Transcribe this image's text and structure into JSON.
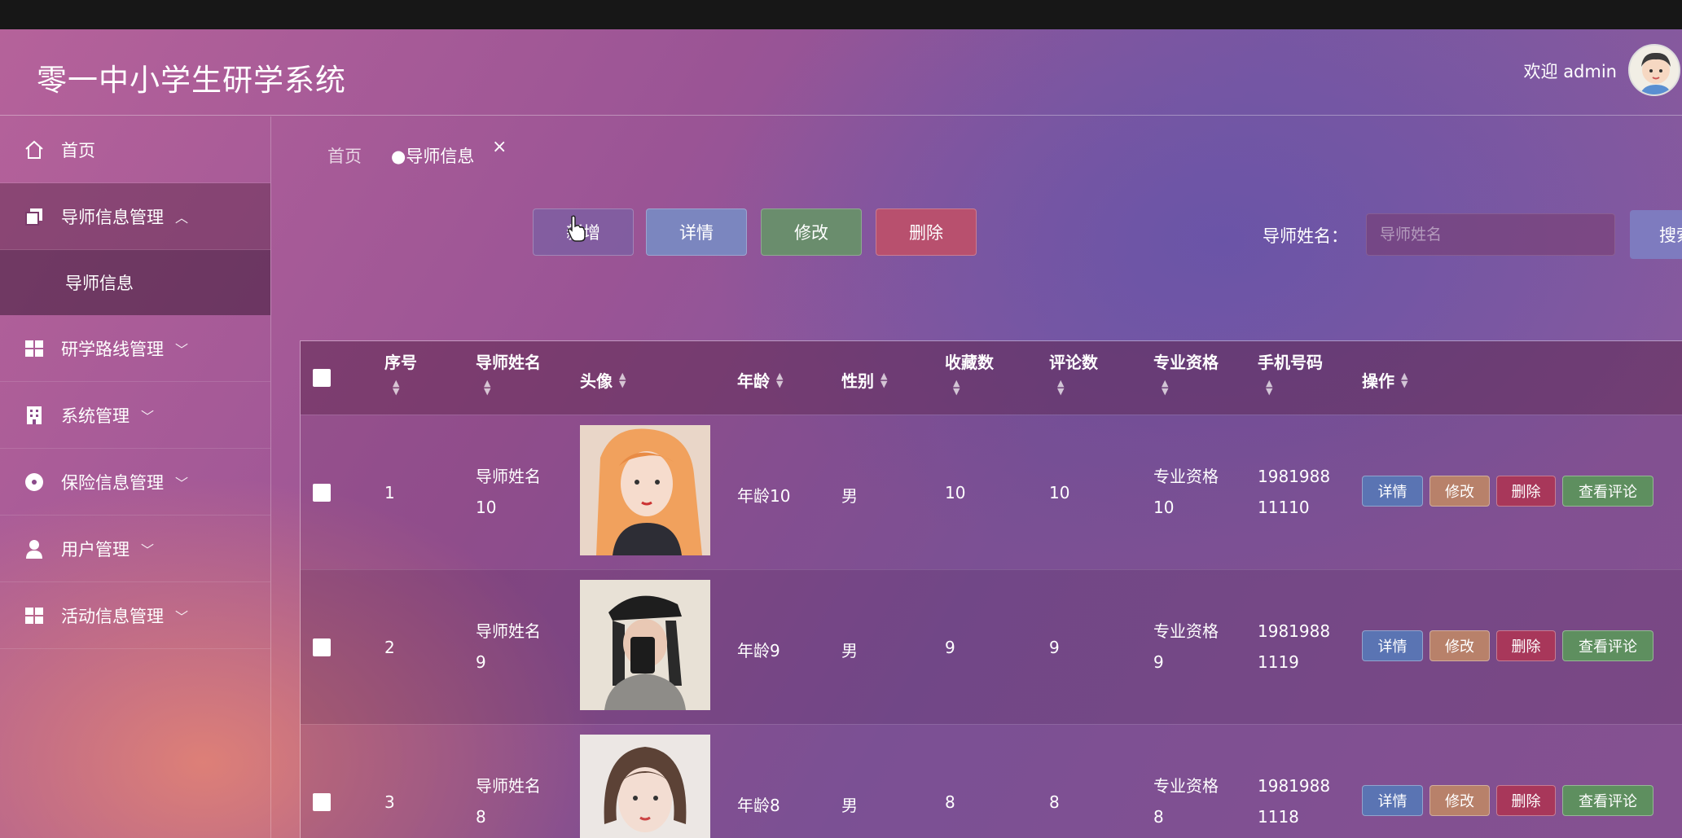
{
  "app": {
    "title": "零一中小学生研学系统",
    "welcome": "欢迎 admin"
  },
  "sidebar": {
    "items": [
      {
        "label": "首页",
        "icon": "home-icon"
      },
      {
        "label": "导师信息管理",
        "icon": "copy-icon",
        "expanded": true
      },
      {
        "label": "导师信息",
        "sub": true
      },
      {
        "label": "研学路线管理",
        "icon": "grid-icon"
      },
      {
        "label": "系统管理",
        "icon": "building-icon"
      },
      {
        "label": "保险信息管理",
        "icon": "compass-icon"
      },
      {
        "label": "用户管理",
        "icon": "user-icon"
      },
      {
        "label": "活动信息管理",
        "icon": "grid-icon"
      }
    ]
  },
  "breadcrumb": {
    "home": "首页",
    "current": "●导师信息",
    "close": "×"
  },
  "toolbar": {
    "add_label": "新增",
    "detail_label": "详情",
    "edit_label": "修改",
    "delete_label": "删除",
    "search_label": "导师姓名：",
    "search_placeholder": "导师姓名",
    "search_button": "搜索"
  },
  "table": {
    "headers": {
      "index": "序号",
      "name": "导师姓名",
      "avatar": "头像",
      "age": "年龄",
      "gender": "性别",
      "favorites": "收藏数",
      "comments": "评论数",
      "qualification": "专业资格",
      "phone": "手机号码",
      "actions": "操作"
    },
    "row_actions": {
      "detail": "详情",
      "edit": "修改",
      "delete": "删除",
      "view_comments": "查看评论"
    },
    "rows": [
      {
        "index": "1",
        "name1": "导师姓名",
        "name2": "10",
        "age": "年龄10",
        "gender": "男",
        "favorites": "10",
        "comments": "10",
        "qual1": "专业资格",
        "qual2": "10",
        "phone1": "1981988",
        "phone2": "11110"
      },
      {
        "index": "2",
        "name1": "导师姓名",
        "name2": "9",
        "age": "年龄9",
        "gender": "男",
        "favorites": "9",
        "comments": "9",
        "qual1": "专业资格",
        "qual2": "9",
        "phone1": "1981988",
        "phone2": "1119"
      },
      {
        "index": "3",
        "name1": "导师姓名",
        "name2": "8",
        "age": "年龄8",
        "gender": "男",
        "favorites": "8",
        "comments": "8",
        "qual1": "专业资格",
        "qual2": "8",
        "phone1": "1981988",
        "phone2": "1118"
      }
    ]
  },
  "colors": {
    "detail_btn": "#5a74b3",
    "edit_btn": "#b8816a",
    "delete_btn": "#a8375a",
    "comment_btn": "#5e8f5f"
  }
}
